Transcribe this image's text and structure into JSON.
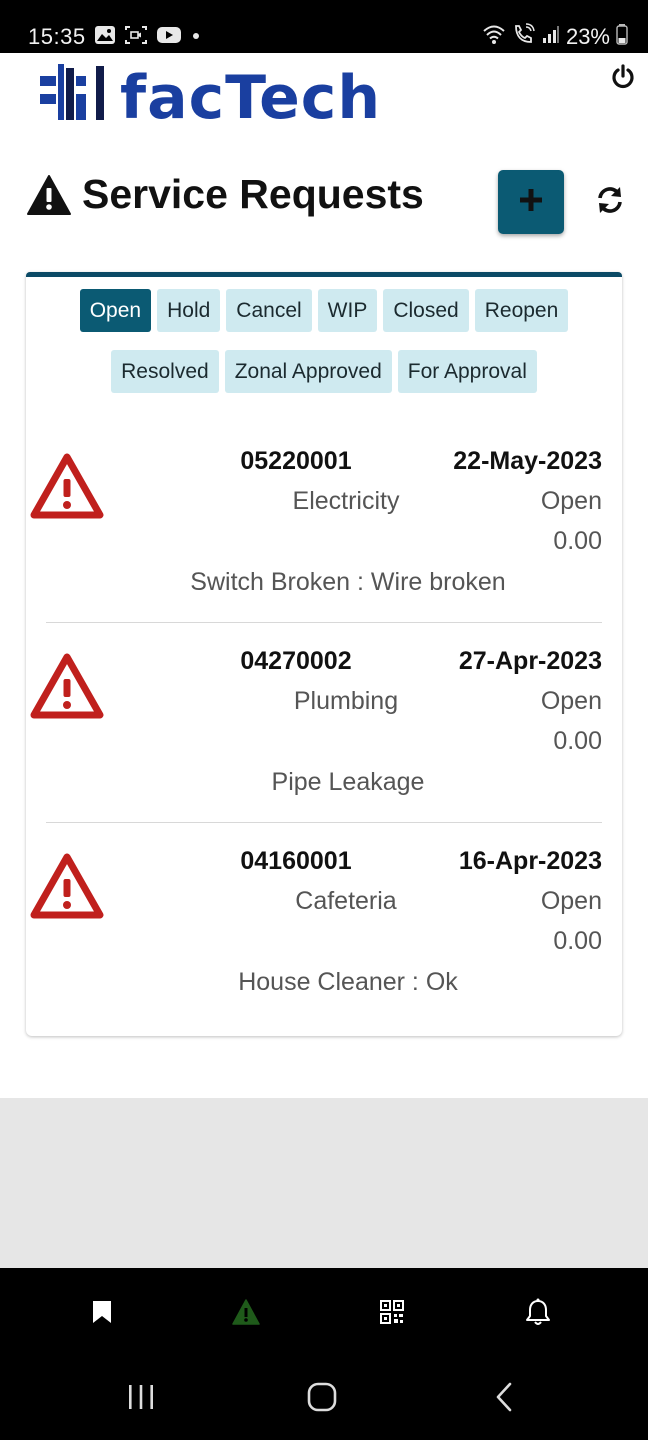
{
  "status_bar": {
    "time": "15:35",
    "battery": "23%",
    "left_icons": [
      "gallery-icon",
      "screen-record-icon",
      "youtube-icon",
      "dot-icon"
    ],
    "right_icons": [
      "wifi-icon",
      "wifi-calling-icon",
      "signal-icon",
      "battery-icon"
    ]
  },
  "header": {
    "logo_text": "facTech",
    "logo_color": "#1a3fa0",
    "power_icon": "power-icon"
  },
  "page": {
    "title": "Service Requests",
    "title_icon": "warning-icon",
    "add_icon": "plus-icon",
    "refresh_icon": "refresh-icon",
    "accent_color": "#0b5a73"
  },
  "tabs": [
    {
      "label": "Open",
      "active": true
    },
    {
      "label": "Hold",
      "active": false
    },
    {
      "label": "Cancel",
      "active": false
    },
    {
      "label": "WIP",
      "active": false
    },
    {
      "label": "Closed",
      "active": false
    },
    {
      "label": "Reopen",
      "active": false
    },
    {
      "label": "Resolved",
      "active": false
    },
    {
      "label": "Zonal Approved",
      "active": false
    },
    {
      "label": "For Approval",
      "active": false
    }
  ],
  "requests": [
    {
      "id": "05220001",
      "date": "22-May-2023",
      "category": "Electricity",
      "status": "Open",
      "amount": "0.00",
      "description": "Switch Broken : Wire broken"
    },
    {
      "id": "04270002",
      "date": "27-Apr-2023",
      "category": "Plumbing",
      "status": "Open",
      "amount": "0.00",
      "description": "Pipe Leakage"
    },
    {
      "id": "04160001",
      "date": "16-Apr-2023",
      "category": "Cafeteria",
      "status": "Open",
      "amount": "0.00",
      "description": "House Cleaner : Ok"
    }
  ],
  "bottom_nav": [
    {
      "icon": "bookmark-icon",
      "active": false
    },
    {
      "icon": "warning-icon",
      "active": true
    },
    {
      "icon": "qr-code-icon",
      "active": false
    },
    {
      "icon": "bell-icon",
      "active": false
    }
  ],
  "system_nav": [
    "recents-icon",
    "home-icon",
    "back-icon"
  ]
}
